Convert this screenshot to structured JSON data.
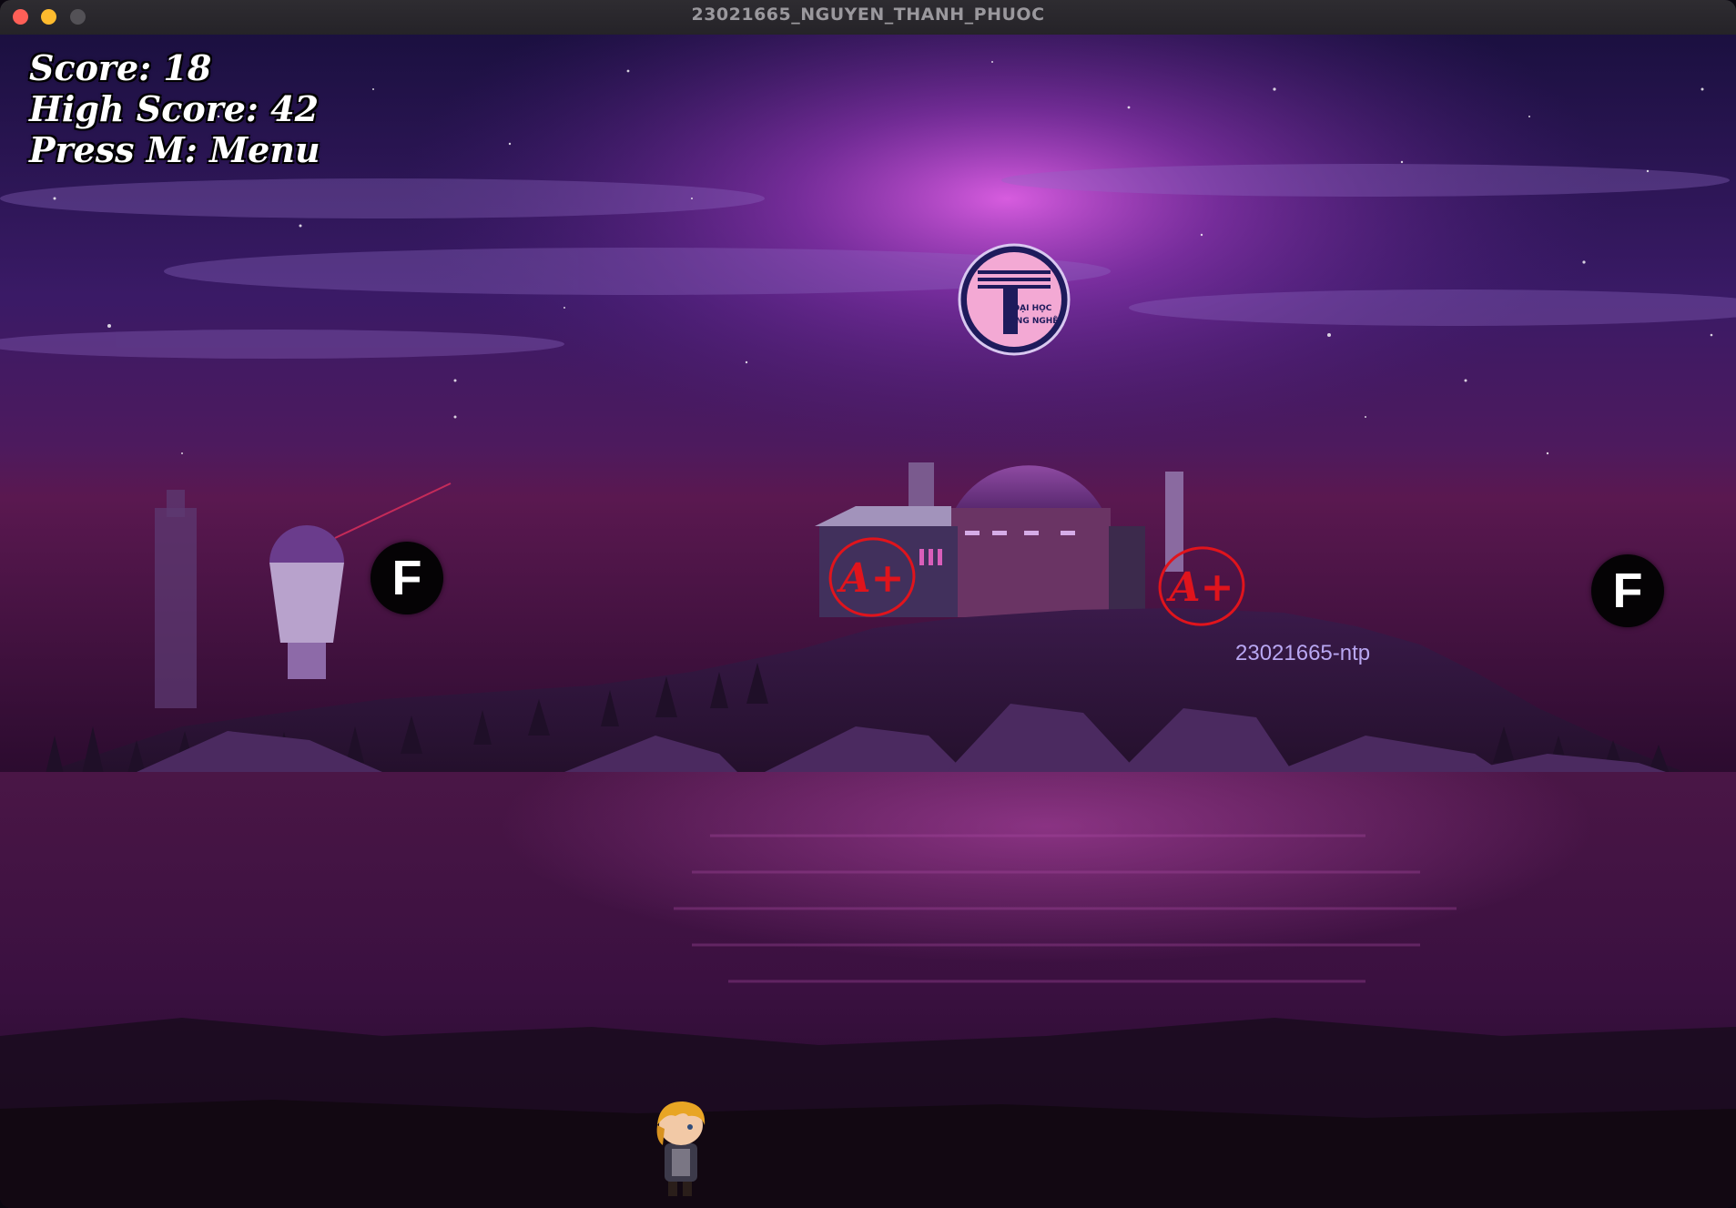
{
  "window": {
    "title": "23021665_NGUYEN_THANH_PHUOC"
  },
  "hud": {
    "score": "Score: 18",
    "high_score": "High Score: 42",
    "menu_hint": "Press M: Menu"
  },
  "obstacles": [
    {
      "label": "F"
    },
    {
      "label": "F"
    }
  ],
  "pickups": [
    {
      "label": "A+"
    },
    {
      "label": "A+"
    }
  ],
  "watermark": "23021665-ntp",
  "logo_text": {
    "line1": "ĐẠI HỌC",
    "line2": "CÔNG NGHỆ"
  },
  "colors": {
    "sky_top": "#1a0d33",
    "glow": "#d24ad0",
    "water": "#3a0f3e",
    "grade_red": "#e0141c"
  }
}
